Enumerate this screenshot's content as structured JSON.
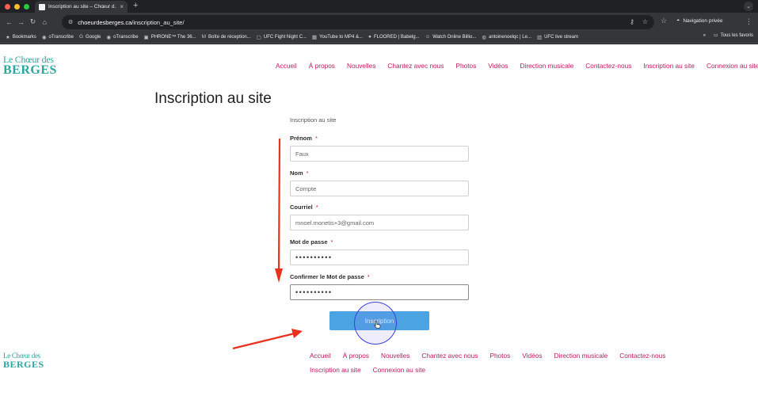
{
  "browser": {
    "tab_title": "Inscription au site – Chœur d...",
    "tab_close": "×",
    "newtab": "+",
    "nav_back": "←",
    "nav_forward": "→",
    "nav_reload": "↻",
    "nav_home": "⌂",
    "url_domain": "choeurdesberges.ca",
    "url_path": "/inscription_au_site/",
    "incognito_label": "Navigation privée",
    "menu_dots": "⋮",
    "chevron": "⌄",
    "colors": {
      "close": "#ff5f57",
      "minimize": "#febc2e",
      "maximize": "#28c840"
    }
  },
  "bookmarks": {
    "items": [
      {
        "label": "Bookmarks",
        "icon": "★"
      },
      {
        "label": "oTranscribe",
        "icon": "◉"
      },
      {
        "label": "Google",
        "icon": "G"
      },
      {
        "label": "oTranscribe",
        "icon": "◉"
      },
      {
        "label": "PHRONE™ The 36...",
        "icon": "▣"
      },
      {
        "label": "Boîte de réception...",
        "icon": "M"
      },
      {
        "label": "UFC Fight Night C...",
        "icon": "▢"
      },
      {
        "label": "YouTube to MP4 &...",
        "icon": "▦"
      },
      {
        "label": "FLOORED | Babelg...",
        "icon": "●"
      },
      {
        "label": "Watch Online Billio...",
        "icon": "☺"
      },
      {
        "label": "antoinenoelqc | Le...",
        "icon": "◍"
      },
      {
        "label": "UFC live stream",
        "icon": "▥"
      }
    ],
    "overflow": "»",
    "all_label": "Tous les favoris"
  },
  "site": {
    "logo_line1": "Le Chœur des",
    "logo_line2": "BERGES",
    "nav": [
      "Accueil",
      "À propos",
      "Nouvelles",
      "Chantez avec nous",
      "Photos",
      "Vidéos",
      "Direction musicale",
      "Contactez-nous",
      "Inscription au site",
      "Connexion au site"
    ]
  },
  "main": {
    "title": "Inscription au site",
    "form_heading": "Inscription au site",
    "required_mark": "*",
    "fields": [
      {
        "label": "Prénom",
        "value": "Faux"
      },
      {
        "label": "Nom",
        "value": "Compte"
      },
      {
        "label": "Courriel",
        "value": "mnoel.monetis+3@gmail.com"
      },
      {
        "label": "Mot de passe",
        "value": "••••••••••"
      },
      {
        "label": "Confirmer le Mot de passe",
        "value": "••••••••••"
      }
    ],
    "submit_label": "Inscription"
  },
  "footer": {
    "nav": [
      "Accueil",
      "À propos",
      "Nouvelles",
      "Chantez avec nous",
      "Photos",
      "Vidéos",
      "Direction musicale",
      "Contactez-nous",
      "Inscription au site",
      "Connexion au site"
    ]
  }
}
